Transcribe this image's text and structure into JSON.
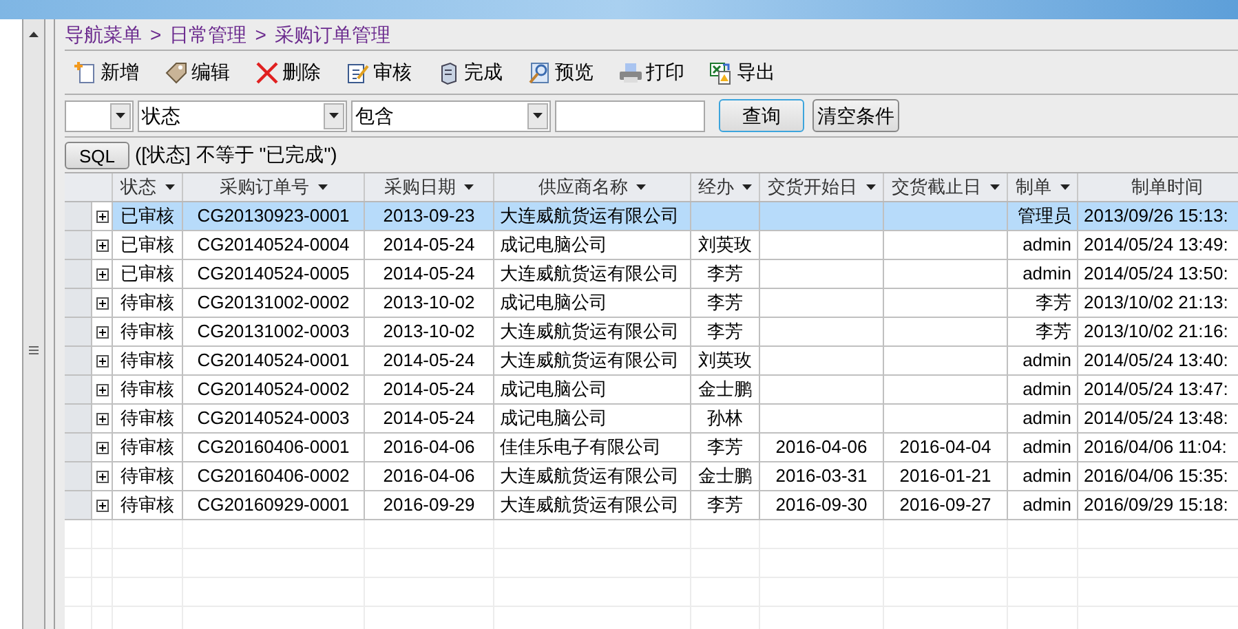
{
  "breadcrumb": [
    {
      "label": "导航菜单"
    },
    {
      "label": "日常管理"
    },
    {
      "label": "采购订单管理"
    }
  ],
  "breadcrumb_separator": ">",
  "toolbar": [
    {
      "label": "新增",
      "kind": "add"
    },
    {
      "label": "编辑",
      "kind": "edit"
    },
    {
      "label": "删除",
      "kind": "delete"
    },
    {
      "label": "审核",
      "kind": "audit"
    },
    {
      "label": "完成",
      "kind": "complete"
    },
    {
      "label": "预览",
      "kind": "preview"
    },
    {
      "label": "打印",
      "kind": "print"
    },
    {
      "label": "导出",
      "kind": "export"
    }
  ],
  "filter": {
    "field": "状态",
    "operator": "包含",
    "query_button": "查询",
    "clear_button": "清空条件"
  },
  "sql": {
    "button": "SQL",
    "expression": "([状态] 不等于 \"已完成\")"
  },
  "table": {
    "columns": [
      {
        "label": "状态",
        "filter": true
      },
      {
        "label": "采购订单号",
        "filter": true
      },
      {
        "label": "采购日期",
        "filter": true
      },
      {
        "label": "供应商名称",
        "filter": true
      },
      {
        "label": "经办",
        "filter": true
      },
      {
        "label": "交货开始日",
        "filter": true
      },
      {
        "label": "交货截止日",
        "filter": true
      },
      {
        "label": "制单",
        "filter": true
      },
      {
        "label": "制单时间",
        "filter": false
      }
    ],
    "rows": [
      {
        "selected": true,
        "cells": [
          "已审核",
          "CG20130923-0001",
          "2013-09-23",
          "大连威航货运有限公司",
          "",
          "",
          "",
          "管理员",
          "2013/09/26 15:13:"
        ]
      },
      {
        "selected": false,
        "cells": [
          "已审核",
          "CG20140524-0004",
          "2014-05-24",
          "成记电脑公司",
          "刘英玫",
          "",
          "",
          "admin",
          "2014/05/24 13:49:"
        ]
      },
      {
        "selected": false,
        "cells": [
          "已审核",
          "CG20140524-0005",
          "2014-05-24",
          "大连威航货运有限公司",
          "李芳",
          "",
          "",
          "admin",
          "2014/05/24 13:50:"
        ]
      },
      {
        "selected": false,
        "cells": [
          "待审核",
          "CG20131002-0002",
          "2013-10-02",
          "成记电脑公司",
          "李芳",
          "",
          "",
          "李芳",
          "2013/10/02 21:13:"
        ]
      },
      {
        "selected": false,
        "cells": [
          "待审核",
          "CG20131002-0003",
          "2013-10-02",
          "大连威航货运有限公司",
          "李芳",
          "",
          "",
          "李芳",
          "2013/10/02 21:16:"
        ]
      },
      {
        "selected": false,
        "cells": [
          "待审核",
          "CG20140524-0001",
          "2014-05-24",
          "大连威航货运有限公司",
          "刘英玫",
          "",
          "",
          "admin",
          "2014/05/24 13:40:"
        ]
      },
      {
        "selected": false,
        "cells": [
          "待审核",
          "CG20140524-0002",
          "2014-05-24",
          "成记电脑公司",
          "金士鹏",
          "",
          "",
          "admin",
          "2014/05/24 13:47:"
        ]
      },
      {
        "selected": false,
        "cells": [
          "待审核",
          "CG20140524-0003",
          "2014-05-24",
          "成记电脑公司",
          "孙林",
          "",
          "",
          "admin",
          "2014/05/24 13:48:"
        ]
      },
      {
        "selected": false,
        "cells": [
          "待审核",
          "CG20160406-0001",
          "2016-04-06",
          "佳佳乐电子有限公司",
          "李芳",
          "2016-04-06",
          "2016-04-04",
          "admin",
          "2016/04/06 11:04:"
        ]
      },
      {
        "selected": false,
        "cells": [
          "待审核",
          "CG20160406-0002",
          "2016-04-06",
          "大连威航货运有限公司",
          "金士鹏",
          "2016-03-31",
          "2016-01-21",
          "admin",
          "2016/04/06 15:35:"
        ]
      },
      {
        "selected": false,
        "cells": [
          "待审核",
          "CG20160929-0001",
          "2016-09-29",
          "大连威航货运有限公司",
          "李芳",
          "2016-09-30",
          "2016-09-27",
          "admin",
          "2016/09/29 15:18:"
        ]
      }
    ]
  }
}
